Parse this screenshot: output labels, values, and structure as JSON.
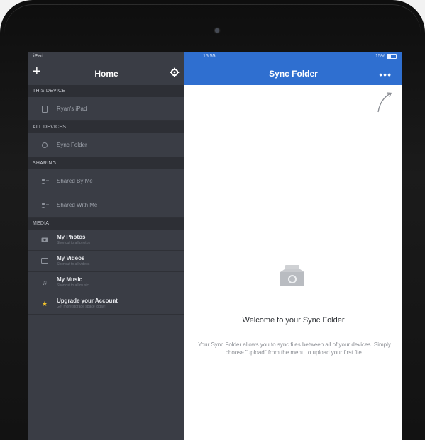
{
  "status_bar": {
    "carrier": "iPad",
    "time": "15:55",
    "battery": "15%"
  },
  "sidebar": {
    "title": "Home",
    "sections": [
      {
        "label": "THIS DEVICE",
        "items": [
          {
            "label": "Ryan's iPad",
            "icon": "tablet-icon"
          }
        ]
      },
      {
        "label": "ALL DEVICES",
        "items": [
          {
            "label": "Sync Folder",
            "icon": "sync-icon"
          }
        ]
      },
      {
        "label": "SHARING",
        "items": [
          {
            "label": "Shared By Me",
            "icon": "person-share-icon"
          },
          {
            "label": "Shared With Me",
            "icon": "person-share-icon"
          }
        ]
      },
      {
        "label": "MEDIA",
        "items": [
          {
            "label": "My Photos",
            "sub": "Shortcut to all photos",
            "icon": "camera-icon"
          },
          {
            "label": "My Videos",
            "sub": "Shortcut to all videos",
            "icon": "video-icon"
          },
          {
            "label": "My Music",
            "sub": "Shortcut to all music",
            "icon": "music-note-icon"
          }
        ]
      }
    ],
    "upgrade": {
      "label": "Upgrade your Account",
      "sub": "Get more storage space today!",
      "icon": "star-icon"
    }
  },
  "main": {
    "title": "Sync Folder",
    "more_label": "•••",
    "welcome_title": "Welcome to your Sync Folder",
    "description": "Your Sync Folder allows you to sync files between all of your devices. Simply choose \"upload\" from the menu to upload your first file."
  },
  "colors": {
    "sidebar_bg": "#3a3d45",
    "header_blue": "#2f6fd0",
    "accent_star": "#f0c22c"
  }
}
